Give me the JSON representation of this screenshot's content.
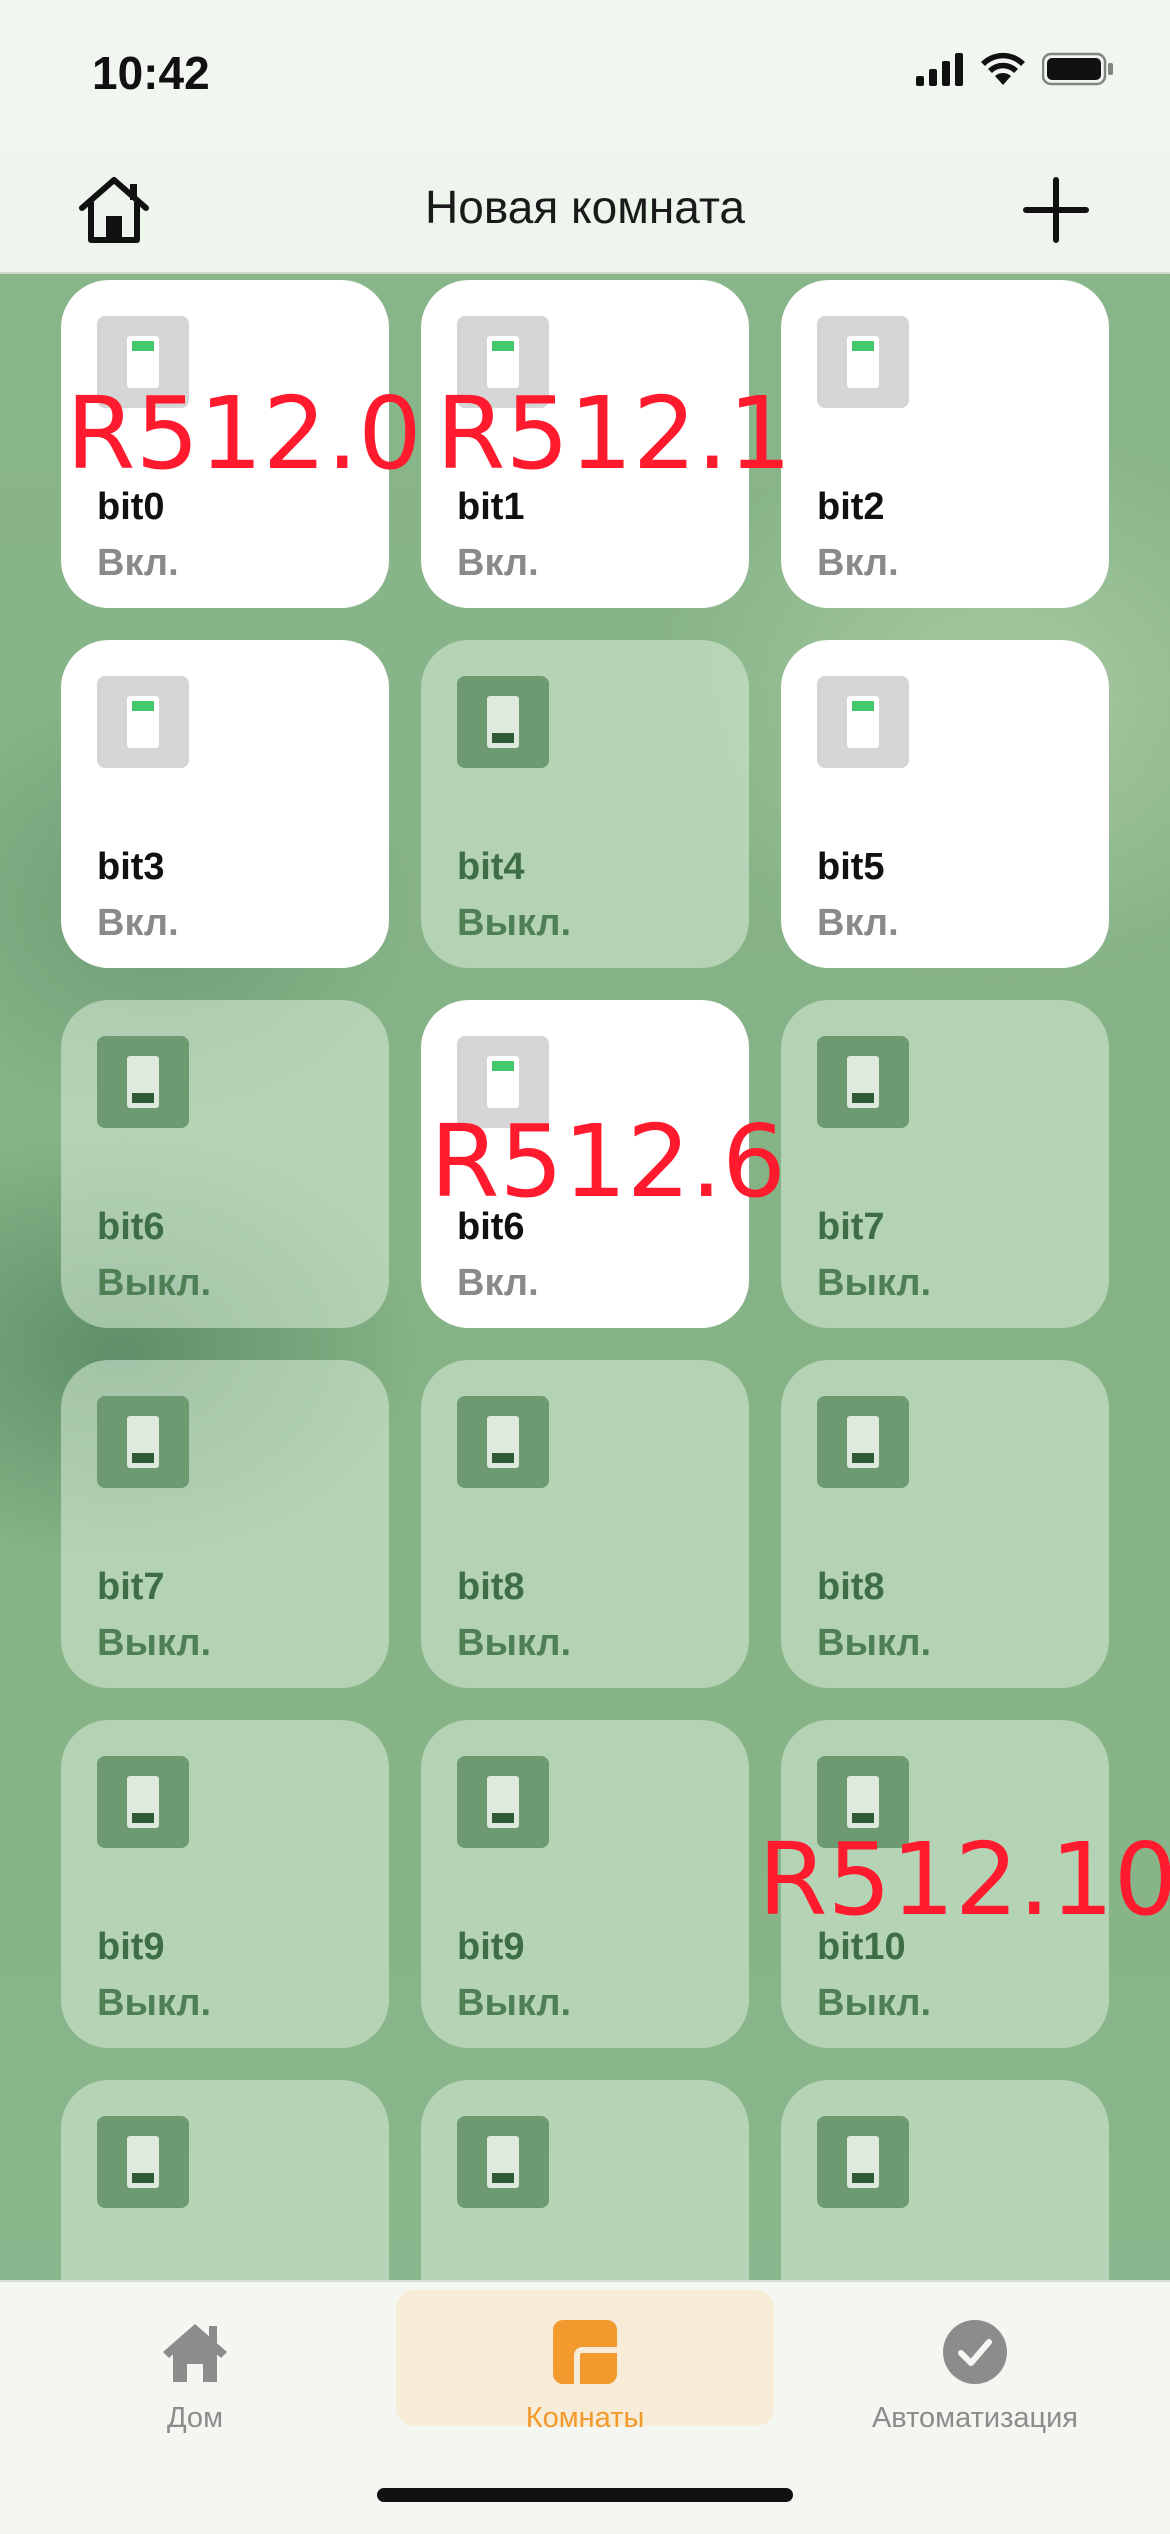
{
  "status": {
    "time": "10:42"
  },
  "nav": {
    "title": "Новая комната"
  },
  "tiles": [
    {
      "name": "bit0",
      "state": "Вкл.",
      "on": true
    },
    {
      "name": "bit1",
      "state": "Вкл.",
      "on": true
    },
    {
      "name": "bit2",
      "state": "Вкл.",
      "on": true
    },
    {
      "name": "bit3",
      "state": "Вкл.",
      "on": true
    },
    {
      "name": "bit4",
      "state": "Выкл.",
      "on": false
    },
    {
      "name": "bit5",
      "state": "Вкл.",
      "on": true
    },
    {
      "name": "bit6",
      "state": "Выкл.",
      "on": false
    },
    {
      "name": "bit6",
      "state": "Вкл.",
      "on": true
    },
    {
      "name": "bit7",
      "state": "Выкл.",
      "on": false
    },
    {
      "name": "bit7",
      "state": "Выкл.",
      "on": false
    },
    {
      "name": "bit8",
      "state": "Выкл.",
      "on": false
    },
    {
      "name": "bit8",
      "state": "Выкл.",
      "on": false
    },
    {
      "name": "bit9",
      "state": "Выкл.",
      "on": false
    },
    {
      "name": "bit9",
      "state": "Выкл.",
      "on": false
    },
    {
      "name": "bit10",
      "state": "Выкл.",
      "on": false
    },
    {
      "name": "",
      "state": "",
      "on": false
    },
    {
      "name": "",
      "state": "",
      "on": false
    },
    {
      "name": "",
      "state": "",
      "on": false
    }
  ],
  "overlays": [
    "R512.0",
    "R512.1",
    "R512.6",
    "R512.10"
  ],
  "tabbar": {
    "home": "Дом",
    "rooms": "Комнаты",
    "automation": "Автоматизация"
  },
  "colors": {
    "accent_tab": "#f29a2e",
    "overlay_red": "#ff1a2e",
    "switch_on": "#43c86b"
  }
}
